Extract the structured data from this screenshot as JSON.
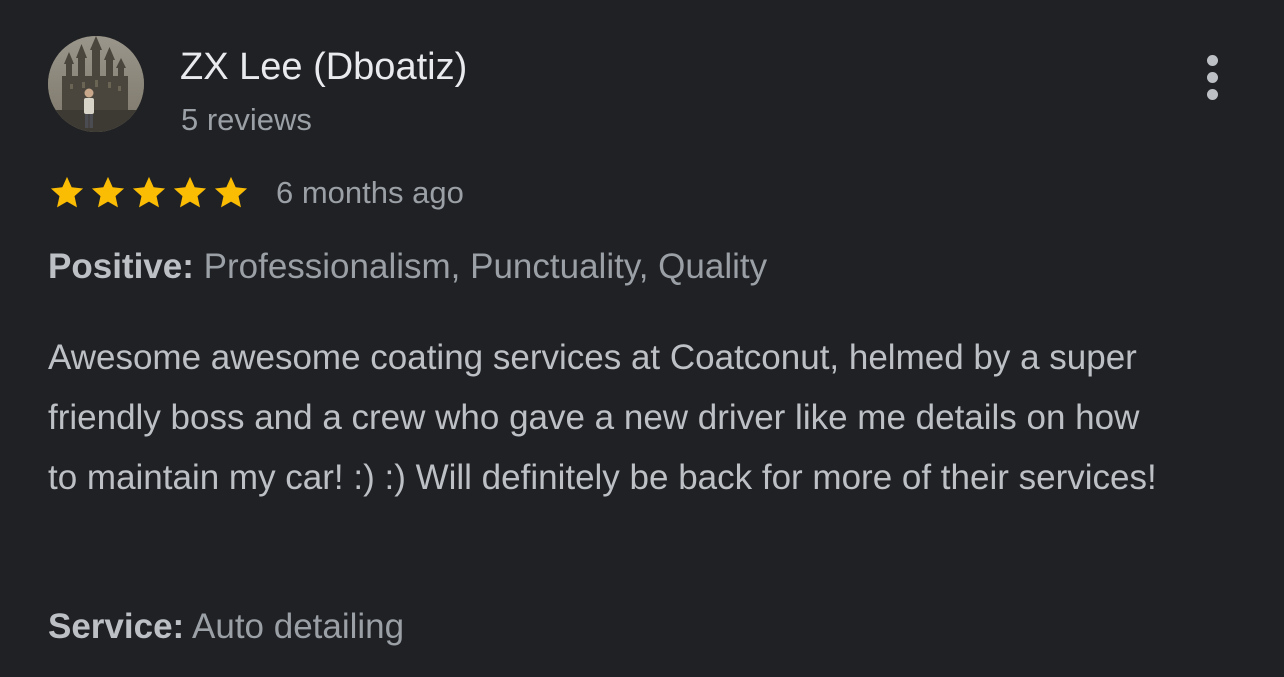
{
  "author": {
    "name": "ZX Lee (Dboatiz)",
    "meta": "5 reviews"
  },
  "more_menu": {
    "icon": "more-vert-icon"
  },
  "review": {
    "rating": 5,
    "rating_max": 5,
    "time": "6 months ago",
    "positive_label": "Positive:",
    "positive_value": "Professionalism, Punctuality, Quality",
    "text": "Awesome awesome coating services at Coatconut, helmed by a super friendly boss and a crew who gave a new driver like me details on how to maintain my car! :) :) Will definitely be back for more of their services!",
    "service_label": "Service:",
    "service_value": "Auto detailing"
  },
  "colors": {
    "background": "#202124",
    "star": "#fbbc04",
    "name": "#e8eaed",
    "body_text": "#bdc1c6",
    "secondary_text": "#9aa0a6"
  }
}
